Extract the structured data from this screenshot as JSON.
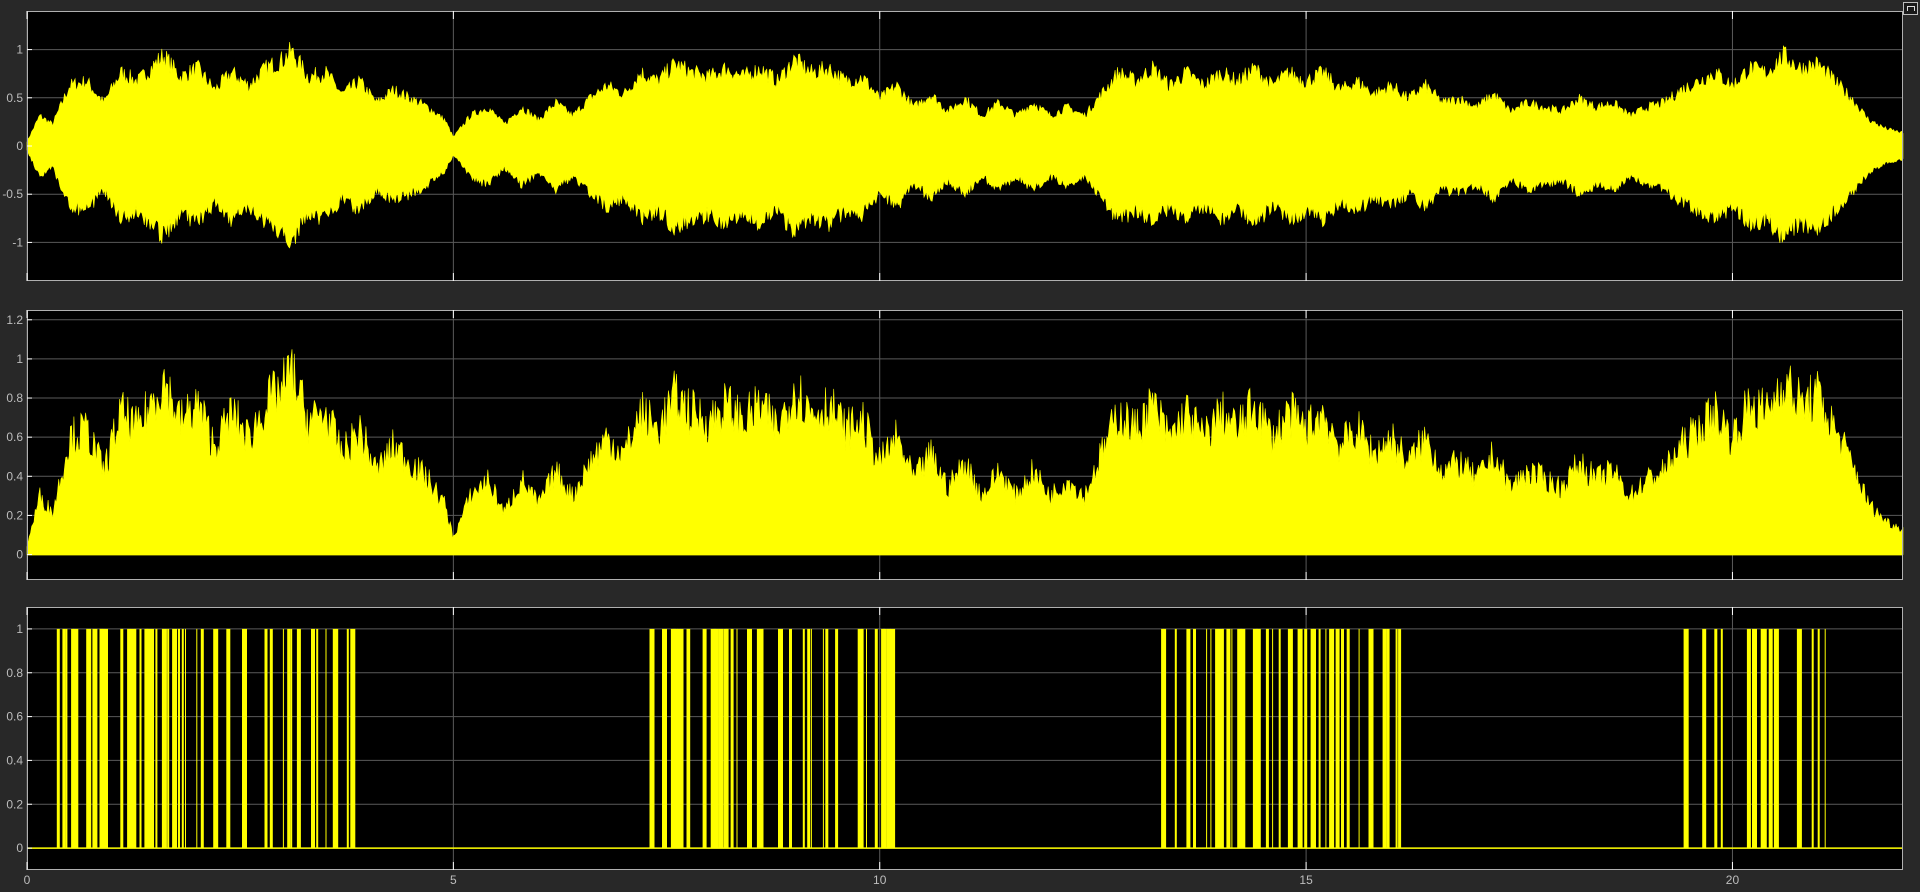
{
  "colors": {
    "background": "#282828",
    "plot_bg": "#000000",
    "trace": "#ffff00",
    "grid": "#5a5a5a",
    "axis": "#ffffff",
    "tick_text": "#bdbdbd"
  },
  "toolbar": {
    "expand_icon": "expand-axes-icon"
  },
  "chart_data": [
    {
      "type": "area",
      "name": "top",
      "xlim": [
        0,
        22
      ],
      "ylim": [
        -1.4,
        1.4
      ],
      "yticks": [
        -1,
        -0.5,
        0,
        0.5,
        1
      ],
      "ytick_labels": [
        "-1",
        "-0.5",
        "0",
        "0.5",
        "1"
      ],
      "grid": true,
      "envelope": {
        "x": [
          0,
          0.15,
          0.3,
          0.5,
          0.7,
          0.9,
          1.1,
          1.3,
          1.5,
          1.6,
          1.8,
          2.0,
          2.2,
          2.4,
          2.6,
          2.8,
          3.0,
          3.1,
          3.3,
          3.5,
          3.7,
          3.9,
          4.1,
          4.3,
          4.5,
          4.7,
          4.9,
          5.0,
          5.2,
          5.4,
          5.6,
          5.8,
          6.0,
          6.2,
          6.4,
          6.6,
          6.8,
          7.0,
          7.2,
          7.4,
          7.6,
          7.8,
          8.0,
          8.2,
          8.4,
          8.6,
          8.8,
          9.0,
          9.2,
          9.4,
          9.6,
          9.8,
          10.0,
          10.2,
          10.4,
          10.6,
          10.8,
          11.0,
          11.2,
          11.4,
          11.6,
          11.8,
          12.0,
          12.2,
          12.4,
          12.6,
          12.8,
          13.0,
          13.2,
          13.4,
          13.6,
          13.8,
          14.0,
          14.2,
          14.4,
          14.6,
          14.8,
          15.0,
          15.2,
          15.4,
          15.6,
          15.8,
          16.0,
          16.2,
          16.4,
          16.6,
          16.8,
          17.0,
          17.2,
          17.4,
          17.6,
          17.8,
          18.0,
          18.2,
          18.4,
          18.6,
          18.8,
          19.0,
          19.2,
          19.4,
          19.6,
          19.8,
          20.0,
          20.2,
          20.4,
          20.6,
          20.8,
          21.0,
          21.2,
          21.4,
          21.6,
          21.8,
          22.0
        ],
        "y": [
          0.05,
          0.35,
          0.25,
          0.7,
          0.75,
          0.5,
          0.85,
          0.75,
          0.95,
          1.05,
          0.8,
          0.9,
          0.65,
          0.85,
          0.7,
          0.9,
          1.0,
          1.1,
          0.8,
          0.85,
          0.6,
          0.75,
          0.5,
          0.65,
          0.55,
          0.45,
          0.3,
          0.1,
          0.35,
          0.45,
          0.25,
          0.45,
          0.3,
          0.5,
          0.35,
          0.55,
          0.7,
          0.6,
          0.85,
          0.75,
          0.95,
          0.85,
          0.8,
          0.9,
          0.8,
          0.9,
          0.75,
          1.0,
          0.85,
          0.9,
          0.75,
          0.8,
          0.55,
          0.7,
          0.45,
          0.6,
          0.4,
          0.55,
          0.35,
          0.5,
          0.35,
          0.5,
          0.35,
          0.45,
          0.35,
          0.6,
          0.85,
          0.75,
          0.9,
          0.7,
          0.85,
          0.7,
          0.85,
          0.75,
          0.9,
          0.7,
          0.85,
          0.75,
          0.85,
          0.65,
          0.75,
          0.6,
          0.7,
          0.55,
          0.7,
          0.5,
          0.55,
          0.45,
          0.6,
          0.4,
          0.5,
          0.45,
          0.4,
          0.55,
          0.45,
          0.5,
          0.35,
          0.45,
          0.5,
          0.65,
          0.75,
          0.85,
          0.7,
          0.9,
          0.85,
          1.05,
          0.9,
          0.95,
          0.75,
          0.55,
          0.3,
          0.2,
          0.15
        ]
      }
    },
    {
      "type": "area",
      "name": "middle",
      "xlim": [
        0,
        22
      ],
      "ylim": [
        -0.13,
        1.25
      ],
      "yticks": [
        0,
        0.2,
        0.4,
        0.6,
        0.8,
        1,
        1.2
      ],
      "ytick_labels": [
        "0",
        "0.2",
        "0.4",
        "0.6",
        "0.8",
        "1",
        "1.2"
      ],
      "grid": true
    },
    {
      "type": "line",
      "name": "bottom",
      "xlim": [
        0,
        22
      ],
      "ylim": [
        -0.1,
        1.1
      ],
      "yticks": [
        0,
        0.2,
        0.4,
        0.6,
        0.8,
        1
      ],
      "ytick_labels": [
        "0",
        "0.2",
        "0.4",
        "0.6",
        "0.8",
        "1"
      ],
      "xticks": [
        0,
        5,
        10,
        15,
        20
      ],
      "xtick_labels": [
        "0",
        "5",
        "10",
        "15",
        "20"
      ],
      "grid": true,
      "pulse_groups": [
        [
          0.35,
          3.8
        ],
        [
          7.3,
          10.2
        ],
        [
          13.3,
          16.1
        ],
        [
          19.4,
          21.1
        ]
      ],
      "pulse_density": 0.55,
      "pulse_singles": [
        0.45,
        0.85,
        3.75,
        16.05,
        21.0
      ]
    }
  ]
}
